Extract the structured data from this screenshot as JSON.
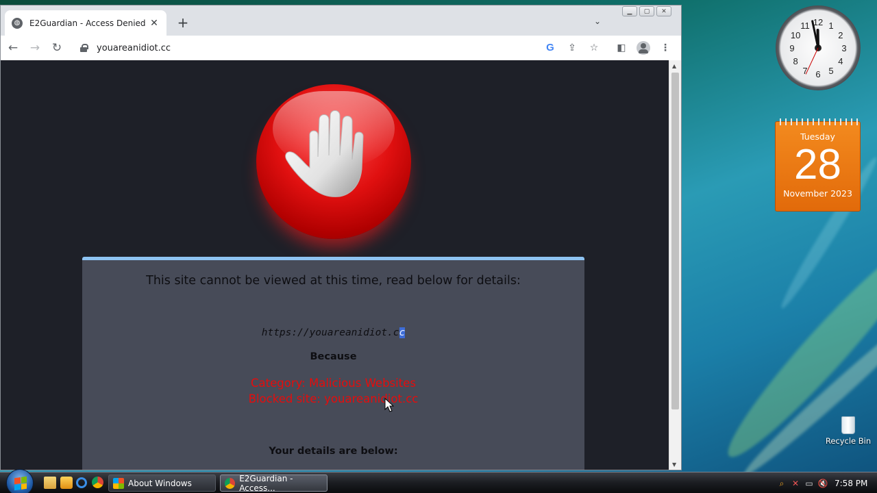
{
  "browser": {
    "tab_title": "E2Guardian - Access Denied",
    "new_tab_symbol": "+",
    "tab_close_symbol": "✕",
    "url": "youareanidiot.cc"
  },
  "page": {
    "heading": "This site cannot be viewed at this time, read below for details:",
    "blocked_url_main": "https://youareanidiot.c",
    "blocked_url_selected": "c",
    "because_label": "Because",
    "category_line": "Category: Malicious Websites",
    "blocked_site_line": "Blocked site: youareanidiot.cc",
    "details_label": "Your details are below:"
  },
  "gadgets": {
    "clock": {
      "numerals": [
        "12",
        "1",
        "2",
        "3",
        "4",
        "5",
        "6",
        "7",
        "8",
        "9",
        "10",
        "11"
      ],
      "time_shown": "11:58"
    },
    "calendar": {
      "weekday": "Tuesday",
      "day": "28",
      "month_year": "November 2023"
    }
  },
  "desktop": {
    "recycle_bin_label": "Recycle Bin"
  },
  "taskbar": {
    "buttons": [
      {
        "label": "About Windows",
        "icon": "windows-flag-icon"
      },
      {
        "label": "E2Guardian - Access...",
        "icon": "chrome-icon"
      }
    ],
    "clock": "7:58 PM",
    "quick_launch": [
      "explorer-icon",
      "media-icon",
      "ie-icon",
      "chrome-icon"
    ]
  },
  "colors": {
    "page_background": "#1e2028",
    "panel_background": "#474b58",
    "panel_accent": "#8ec3f2",
    "reason_red": "#e60c0c",
    "calendar_orange": "#f38a1e"
  }
}
